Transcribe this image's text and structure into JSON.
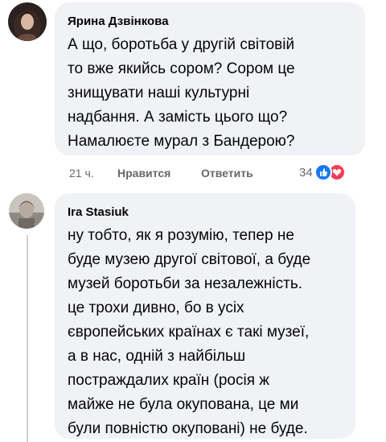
{
  "comments": [
    {
      "author": "Ярина Дзвінкова",
      "text_lines": [
        "А що, боротьба у другій світовій",
        "то вже якийсь сором? Сором це",
        "знищувати наші культурні",
        "надбання. А замість цього що?",
        "Намалюєте мурал з Бандерою?"
      ],
      "time": "21 ч.",
      "like_label": "Нравится",
      "reply_label": "Ответить",
      "reaction_count": "34",
      "reactions": [
        "like-icon",
        "love-icon"
      ]
    },
    {
      "author": "Ira Stasiuk",
      "text_lines": [
        "ну тобто, як я розумію, тепер не",
        "буде музею другої світової, а буде",
        "музей боротьби за незалежність.",
        "це трохи дивно, бо в усіх",
        "європейських країнах є такі музеї,",
        "а в нас, одній з найбільш",
        "постраждалих країн (росія ж",
        "майже не була окупована, це ми",
        "були повністю окуповані) не буде."
      ]
    }
  ],
  "colors": {
    "bubble": "#f0f2f5",
    "secondary_text": "#65676b",
    "like": "#1877f2",
    "love": "#f33e58"
  }
}
